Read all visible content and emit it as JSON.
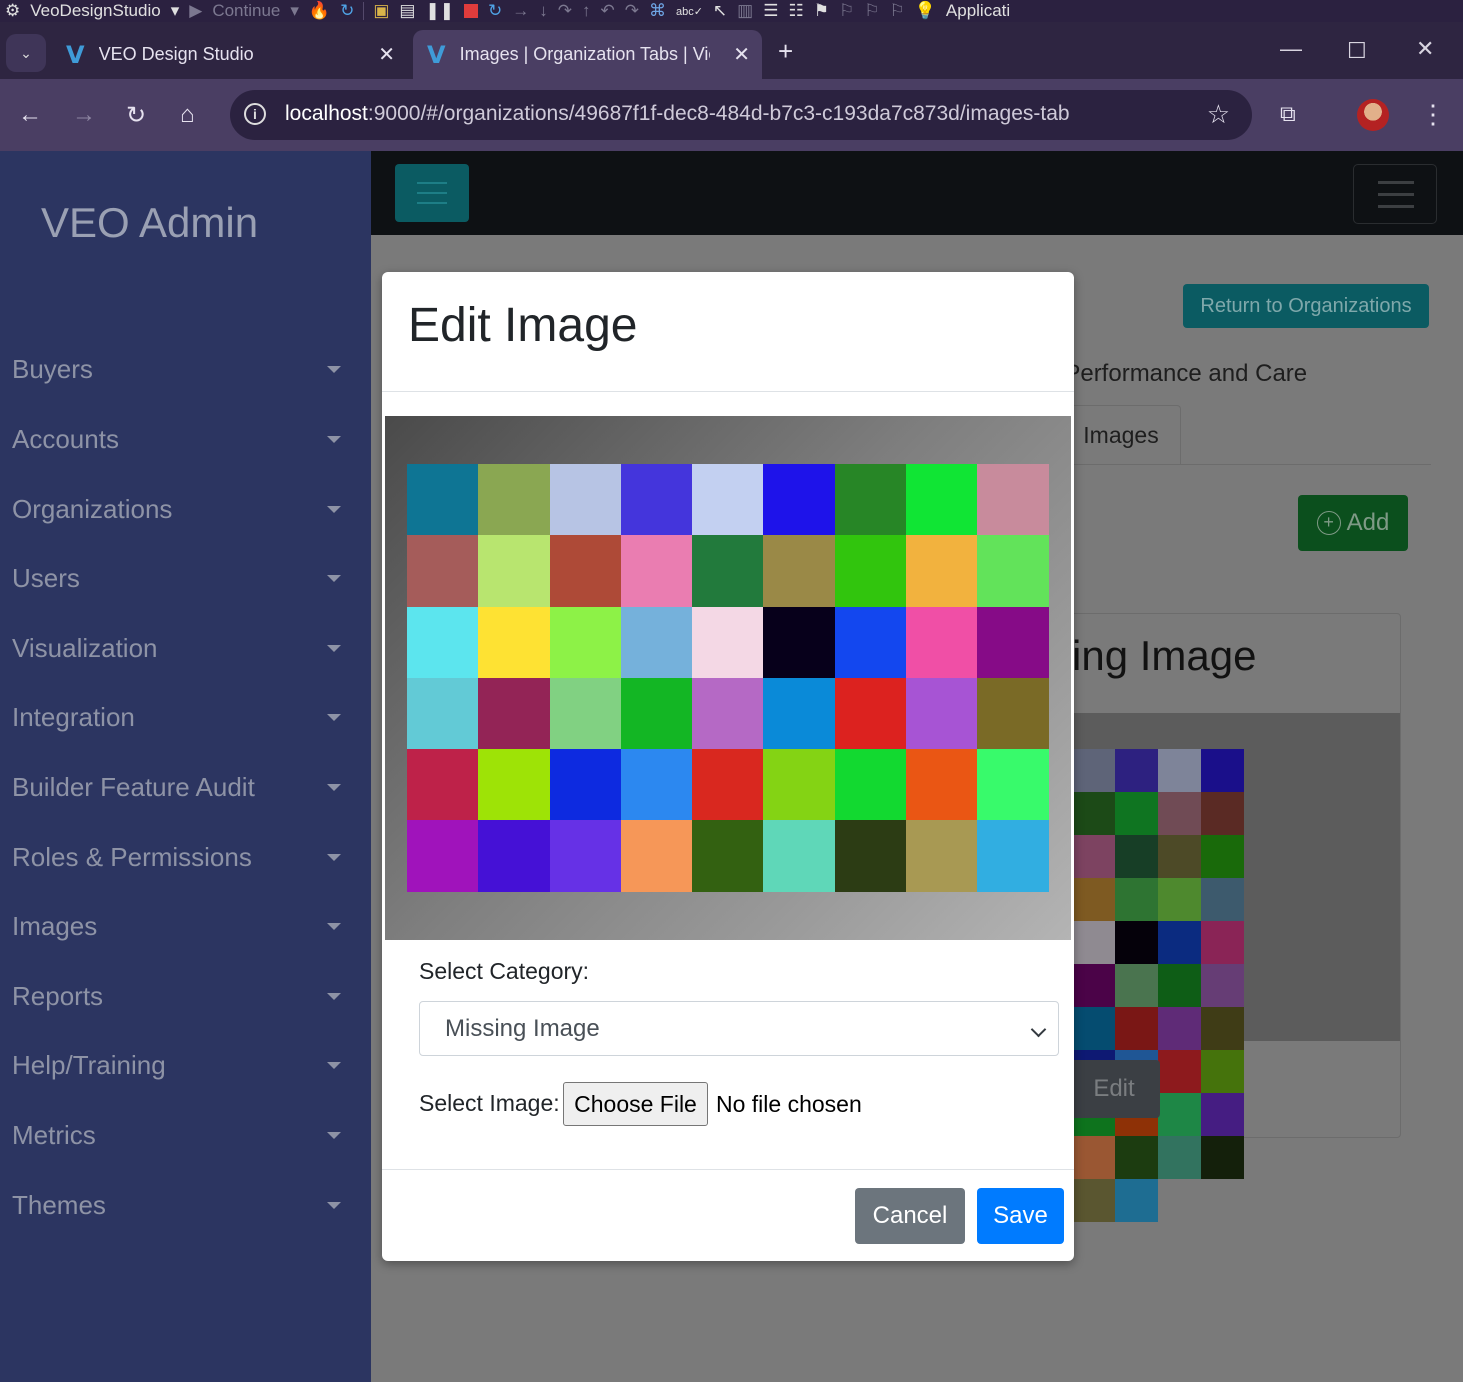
{
  "ide_toolbar": {
    "solution_name": "VeoDesignStudio",
    "continue_label": "Continue",
    "right_label": "Applicati"
  },
  "browser": {
    "tabs": [
      {
        "title": "VEO Design Studio",
        "active": false
      },
      {
        "title": "Images | Organization Tabs | Vie",
        "active": true
      }
    ],
    "url_host": "localhost",
    "url_path": ":9000/#/organizations/49687f1f-dec8-484d-b7c3-c193da7c873d/images-tab"
  },
  "sidebar": {
    "title": "VEO Admin",
    "items": [
      {
        "label": "Buyers"
      },
      {
        "label": "Accounts"
      },
      {
        "label": "Organizations"
      },
      {
        "label": "Users"
      },
      {
        "label": "Visualization"
      },
      {
        "label": "Integration"
      },
      {
        "label": "Builder Feature Audit"
      },
      {
        "label": "Roles & Permissions"
      },
      {
        "label": "Images"
      },
      {
        "label": "Reports"
      },
      {
        "label": "Help/Training"
      },
      {
        "label": "Metrics"
      },
      {
        "label": "Themes"
      }
    ]
  },
  "page": {
    "return_label": "Return to Organizations",
    "org_subtitle_visible": "t Performance and Care",
    "tab_images_label": "Images",
    "add_label": "Add",
    "card_title_visible": "ing Image",
    "card_edit_visible": "Edit"
  },
  "modal": {
    "title": "Edit Image",
    "category_label": "Select Category:",
    "category_value": "Missing Image",
    "image_label": "Select Image:",
    "choose_file_label": "Choose File",
    "no_file_label": "No file chosen",
    "cancel_label": "Cancel",
    "save_label": "Save"
  },
  "colors": {
    "preview_grid": [
      "#0e7594",
      "#8aa752",
      "#b7c4e4",
      "#4435dc",
      "#c3d0f1",
      "#1e13ea",
      "#278626",
      "#10e534",
      "#c88b9c",
      "#a55c5a",
      "#b8e56f",
      "#ae4a37",
      "#ea7db1",
      "#227a3c",
      "#9a8947",
      "#31c50d",
      "#f2b23e",
      "#62e35a",
      "#5ce5ee",
      "#fee233",
      "#8df247",
      "#75b1db",
      "#f4d8e5",
      "#07001b",
      "#1347ef",
      "#f04fa6",
      "#860b87",
      "#62cad6",
      "#932456",
      "#81d182",
      "#13b624",
      "#b569c5",
      "#0a8ad8",
      "#dc221f",
      "#a754d4",
      "#7a6a26",
      "#be2249",
      "#9ee306",
      "#0d2ae0",
      "#2c88f0",
      "#d9281f",
      "#84d314",
      "#12d930",
      "#ea5614",
      "#38fa6b",
      "#a013bb",
      "#4511d6",
      "#6631e6",
      "#f69758",
      "#336111",
      "#5fd7b8",
      "#2c3c14",
      "#a89953",
      "#31aee1"
    ],
    "card_grid": [
      "#5e6478",
      "#2d2180",
      "#7e8499",
      "#1a0f8a",
      "#1c4a17",
      "#0f7521",
      "#704b55",
      "#5a2a24",
      "#7d4361",
      "#173e26",
      "#4d4a27",
      "#196a0a",
      "#7e5a22",
      "#2e7432",
      "#4e892e",
      "#3d5a6d",
      "#8f8a91",
      "#05010a",
      "#0b2b80",
      "#8a2456",
      "#4b0348",
      "#4a744f",
      "#0e5d16",
      "#663d75",
      "#054c70",
      "#7a1715",
      "#5f2b77",
      "#3f3c16",
      "#0e1973",
      "#1f5695",
      "#8d1a1d",
      "#45730c",
      "#0e731d",
      "#8e3106",
      "#1e8746",
      "#451d82",
      "#9a5733",
      "#1c3c10",
      "#32735f",
      "#14200b",
      "#5a5630",
      "#1e6d92"
    ]
  }
}
